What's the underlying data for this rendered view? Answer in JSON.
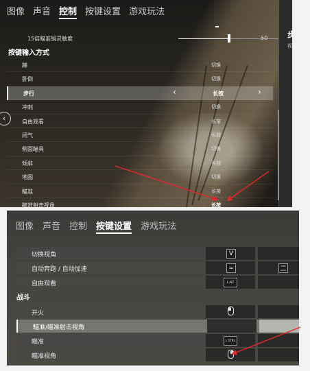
{
  "panel1": {
    "tabs": [
      "图像",
      "声音",
      "控制",
      "按键设置",
      "游戏玩法"
    ],
    "active_tab": 2,
    "slider": {
      "label": "15倍瞄准镜灵敏度",
      "value": "50",
      "fraction": 0.5
    },
    "section_title": "按键输入方式",
    "rows": [
      {
        "label": "蹲",
        "value": "切换"
      },
      {
        "label": "卧倒",
        "value": "切换"
      },
      {
        "label": "步行",
        "value": "长按",
        "selected": true
      },
      {
        "label": "冲刺",
        "value": "切换"
      },
      {
        "label": "自由观看",
        "value": "长按"
      },
      {
        "label": "闭气",
        "value": "长按"
      },
      {
        "label": "侧面瞄具",
        "value": "切换"
      },
      {
        "label": "倾斜",
        "value": "长按"
      },
      {
        "label": "地图",
        "value": "切换"
      },
      {
        "label": "瞄准",
        "value": "长按"
      },
      {
        "label": "瞄准射击视角",
        "value": "长按",
        "highlight": true
      }
    ],
    "right_panel": {
      "title": "步",
      "subtitle": "视"
    },
    "back_icon": "chevron-left-icon",
    "arrow_left": "‹",
    "arrow_right": "›"
  },
  "panel2": {
    "tabs": [
      "图像",
      "声音",
      "控制",
      "按键设置",
      "游戏玩法"
    ],
    "active_tab": 3,
    "rows_top": [
      {
        "label": "切换视角",
        "key1": "V",
        "key2": ""
      },
      {
        "label": "自动奔跑 / 自动加速",
        "key1": "=",
        "key2": "NUM LOCK"
      },
      {
        "label": "自由观看",
        "key1": "L ALT",
        "key2": ""
      }
    ],
    "section_title": "战斗",
    "rows_bottom": [
      {
        "label": "开火",
        "key1_icon": "mouse-left-icon",
        "key2": ""
      },
      {
        "label": "瞄准/瞄准射击视角",
        "key1": "",
        "key2": "",
        "selected": true
      },
      {
        "label": "瞄准",
        "key1": "L CTRL",
        "key2": ""
      },
      {
        "label": "瞄准视角",
        "key1_icon": "mouse-right-icon",
        "key2": ""
      }
    ]
  },
  "colors": {
    "annotation_arrow": "#e8262b",
    "active_tab": "#ffffff"
  }
}
